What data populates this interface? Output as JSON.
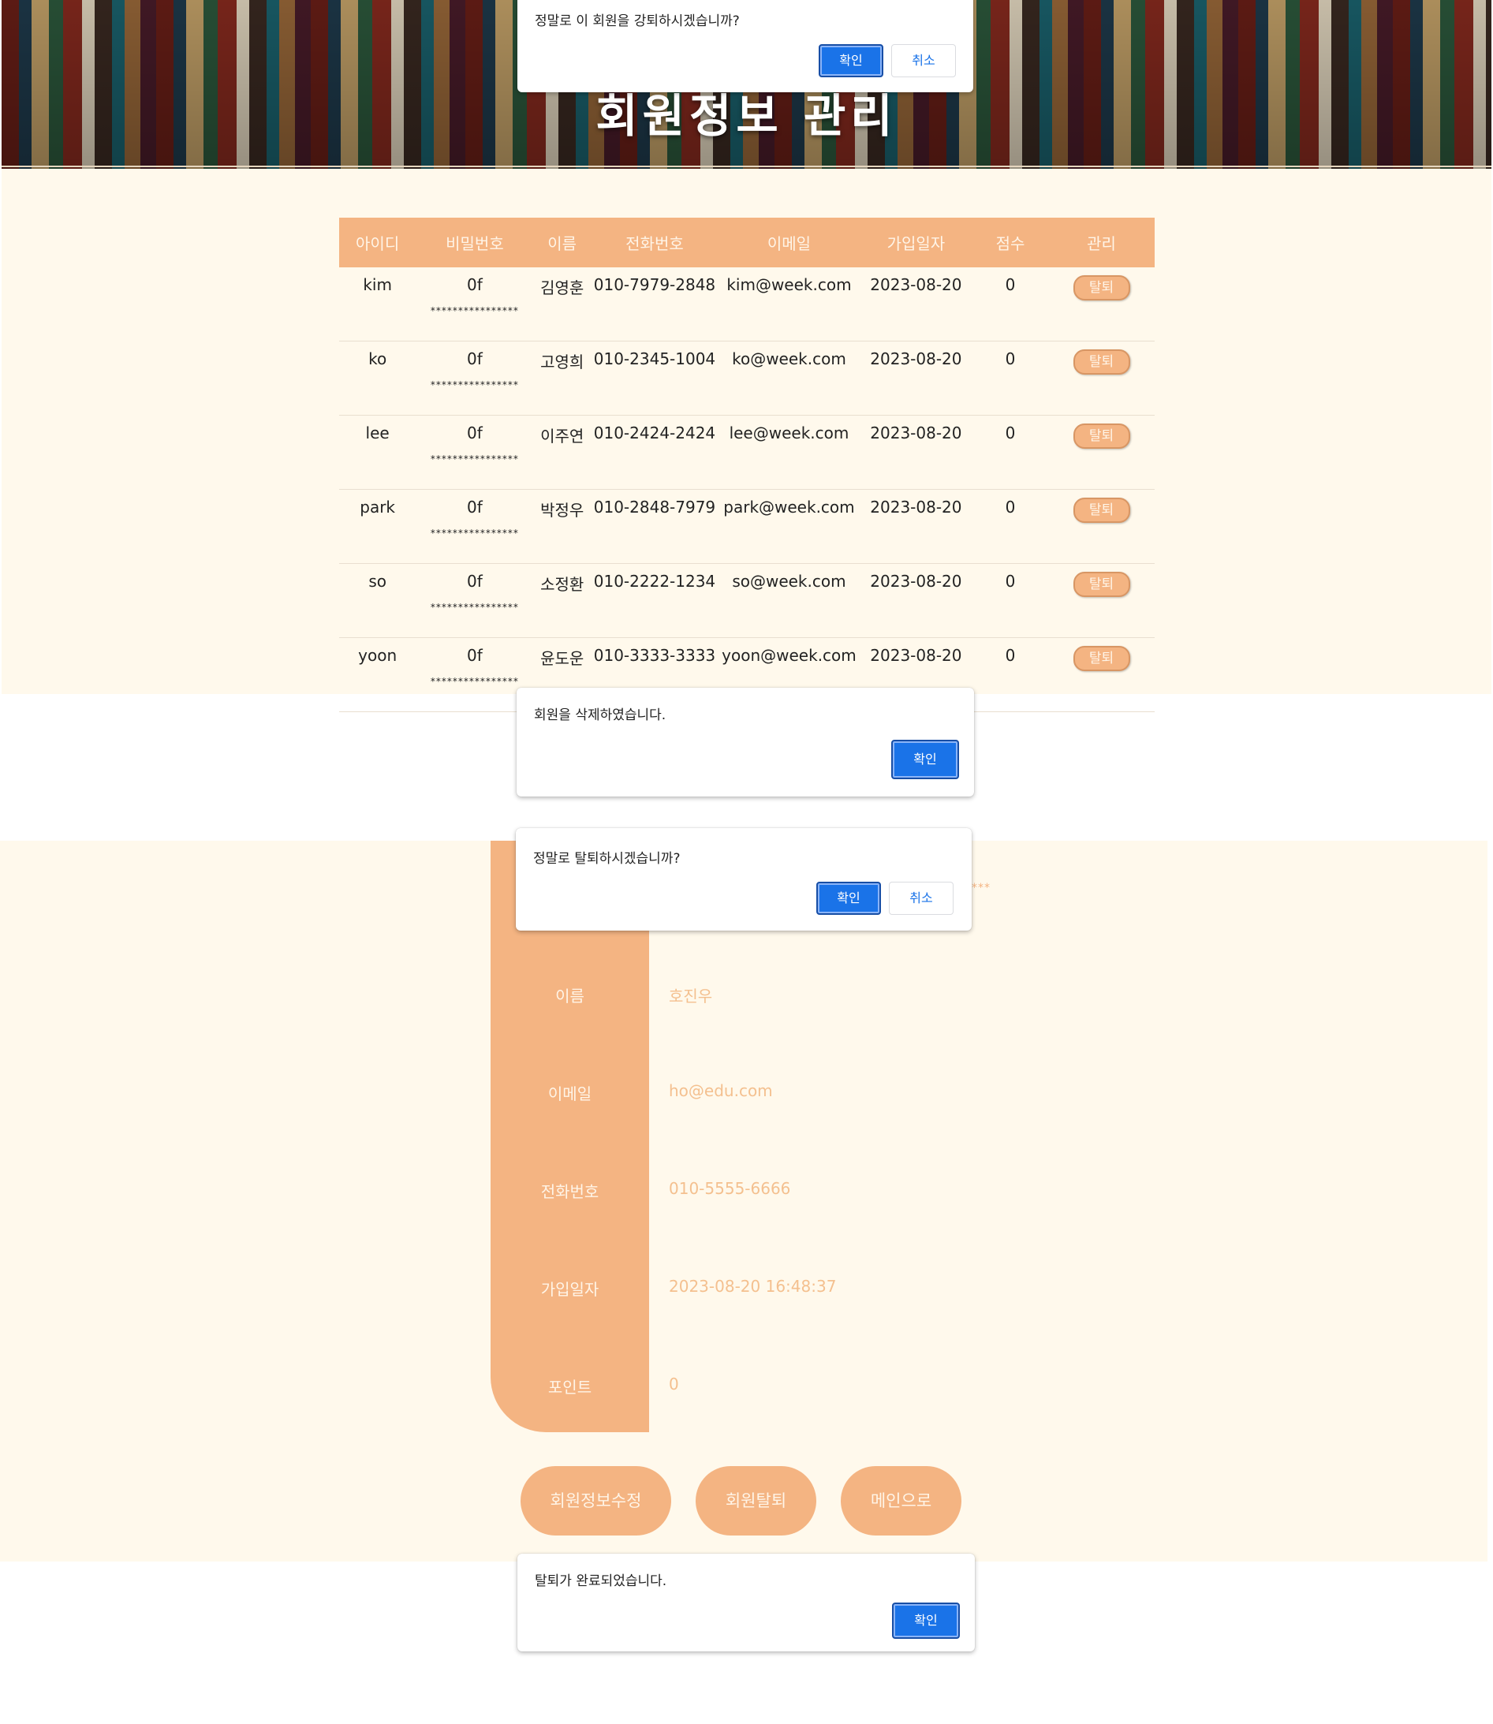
{
  "banner": {
    "title": "회원정보 관리"
  },
  "admin": {
    "columns": [
      "아이디",
      "비밀번호",
      "이름",
      "전화번호",
      "이메일",
      "가입일자",
      "점수",
      "관리"
    ],
    "withdraw_label": "탈퇴",
    "members": [
      {
        "id": "kim",
        "pw": "0f",
        "pw_mask": "****************",
        "name": "김영훈",
        "phone": "010-7979-2848",
        "email": "kim@week.com",
        "joined": "2023-08-20",
        "score": "0"
      },
      {
        "id": "ko",
        "pw": "0f",
        "pw_mask": "****************",
        "name": "고영희",
        "phone": "010-2345-1004",
        "email": "ko@week.com",
        "joined": "2023-08-20",
        "score": "0"
      },
      {
        "id": "lee",
        "pw": "0f",
        "pw_mask": "****************",
        "name": "이주연",
        "phone": "010-2424-2424",
        "email": "lee@week.com",
        "joined": "2023-08-20",
        "score": "0"
      },
      {
        "id": "park",
        "pw": "0f",
        "pw_mask": "****************",
        "name": "박정우",
        "phone": "010-2848-7979",
        "email": "park@week.com",
        "joined": "2023-08-20",
        "score": "0"
      },
      {
        "id": "so",
        "pw": "0f",
        "pw_mask": "****************",
        "name": "소정환",
        "phone": "010-2222-1234",
        "email": "so@week.com",
        "joined": "2023-08-20",
        "score": "0"
      },
      {
        "id": "yoon",
        "pw": "0f",
        "pw_mask": "****************",
        "name": "윤도운",
        "phone": "010-3333-3333",
        "email": "yoon@week.com",
        "joined": "2023-08-20",
        "score": "0"
      }
    ]
  },
  "dialogs": {
    "force_delete": {
      "message": "정말로 이 회원을 강퇴하시겠습니까?",
      "ok": "확인",
      "cancel": "취소"
    },
    "deleted": {
      "message": "회원을 삭제하였습니다.",
      "ok": "확인"
    },
    "withdraw": {
      "message": "정말로 탈퇴하시겠습니까?",
      "ok": "확인",
      "cancel": "취소"
    },
    "withdrawn": {
      "message": "탈퇴가 완료되었습니다.",
      "ok": "확인"
    }
  },
  "mypage": {
    "star_trail": "***",
    "fields": [
      {
        "label": "이름",
        "value": "호진우"
      },
      {
        "label": "이메일",
        "value": "ho@edu.com"
      },
      {
        "label": "전화번호",
        "value": "010-5555-6666"
      },
      {
        "label": "가입일자",
        "value": "2023-08-20 16:48:37"
      },
      {
        "label": "포인트",
        "value": "0"
      }
    ],
    "buttons": {
      "edit": "회원정보수정",
      "withdraw": "회원탈퇴",
      "main": "메인으로"
    }
  },
  "colors": {
    "accent": "#f4b482",
    "page_bg": "#fff9ec",
    "dialog_ok": "#1a73e8"
  }
}
